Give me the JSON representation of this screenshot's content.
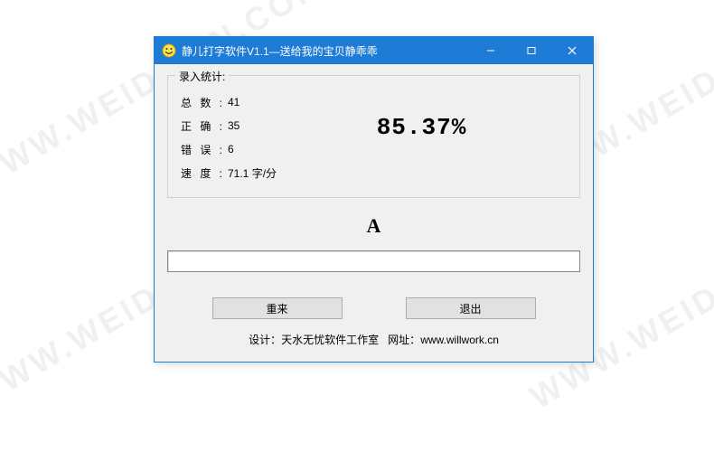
{
  "window": {
    "title": "静儿打字软件V1.1—送给我的宝贝静乖乖"
  },
  "stats": {
    "legend": "录入统计:",
    "total_label": "总数:",
    "total_value": "41",
    "correct_label": "正确:",
    "correct_value": "35",
    "error_label": "错误:",
    "error_value": "6",
    "speed_label": "速度:",
    "speed_value": "71.1 字/分",
    "percent": "85.37%"
  },
  "prompt_char": "A",
  "input_value": "",
  "buttons": {
    "retry": "重来",
    "exit": "退出"
  },
  "footer": {
    "design_label": "设计：",
    "design_value": "天水无忧软件工作室",
    "url_label": "网址：",
    "url_value": "www.willwork.cn"
  },
  "watermark": "WWW.WEIDOWN.COM"
}
